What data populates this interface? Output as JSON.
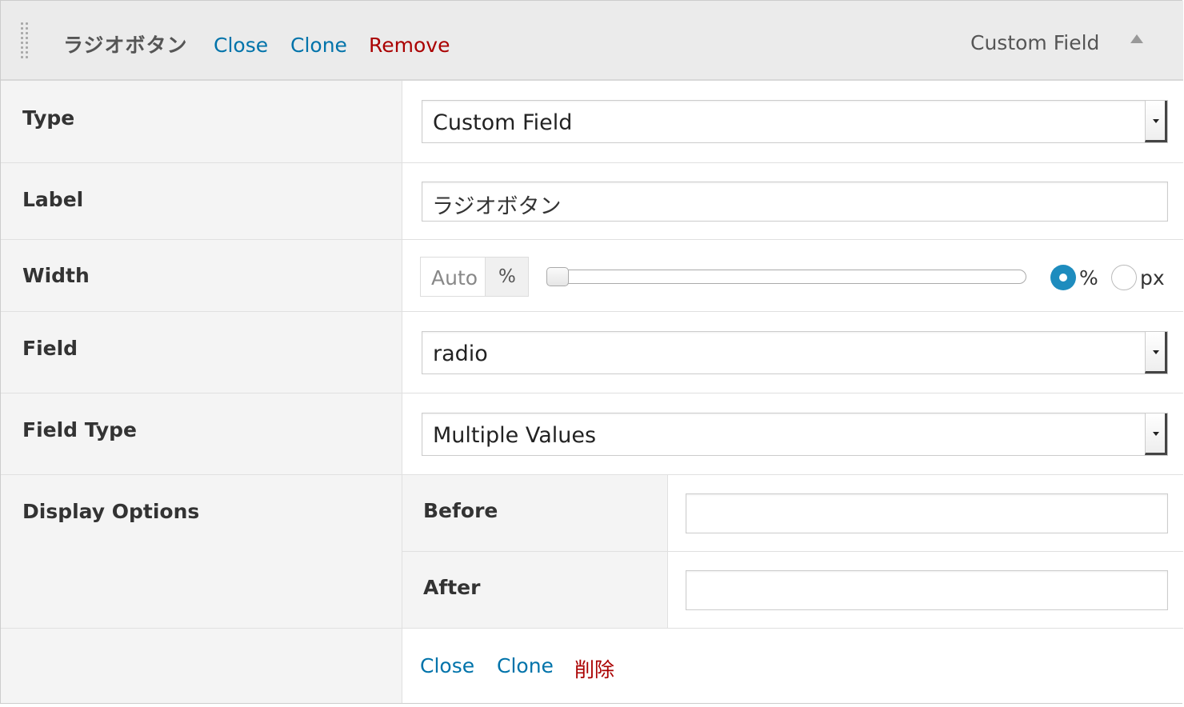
{
  "header": {
    "title": "ラジオボタン",
    "close_label": "Close",
    "clone_label": "Clone",
    "remove_label": "Remove",
    "type_label": "Custom Field"
  },
  "rows": {
    "type": {
      "label": "Type",
      "value": "Custom Field"
    },
    "label": {
      "label": "Label",
      "value": "ラジオボタン"
    },
    "width": {
      "label": "Width",
      "value_placeholder": "Auto",
      "unit_addon": "%",
      "slider_value": 0,
      "unit_options": [
        "%",
        "px"
      ],
      "selected_unit": "%"
    },
    "field": {
      "label": "Field",
      "value": "radio"
    },
    "field_type": {
      "label": "Field Type",
      "value": "Multiple Values"
    },
    "display_options": {
      "label": "Display Options",
      "before_label": "Before",
      "before_value": "",
      "after_label": "After",
      "after_value": ""
    }
  },
  "footer": {
    "close_label": "Close",
    "clone_label": "Clone",
    "remove_label": "削除"
  },
  "colors": {
    "link": "#0073aa",
    "remove": "#aa0000",
    "radio_selected": "#1e8cbe"
  }
}
